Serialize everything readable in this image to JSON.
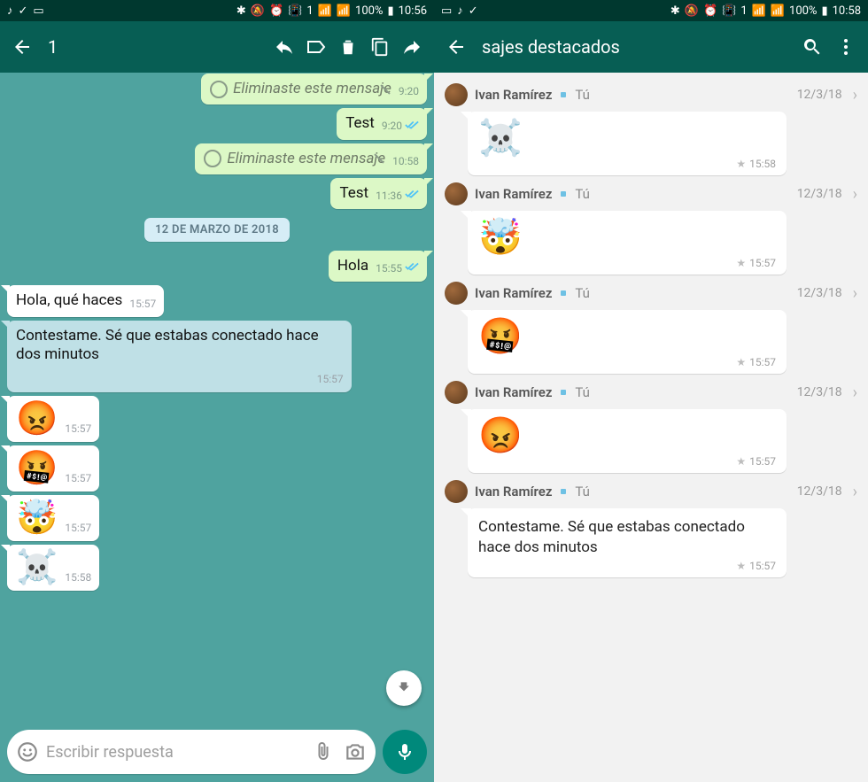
{
  "left": {
    "status": {
      "time": "10:56",
      "battery": "100%",
      "icons_left": [
        "♪",
        "✓",
        "▭"
      ],
      "icons_right": [
        "✱",
        "🔕",
        "⏰",
        "📳",
        "1",
        "📶",
        "📶"
      ]
    },
    "actionbar": {
      "back": "←",
      "count": "1",
      "reply_icon": "reply",
      "label_icon": "label",
      "delete_icon": "delete",
      "copy_icon": "copy",
      "forward_icon": "forward"
    },
    "messages": [
      {
        "kind": "out",
        "deleted": true,
        "text": "Eliminaste este mensaje",
        "time": "9:20",
        "cut": true
      },
      {
        "kind": "out",
        "text": "Test",
        "time": "9:20",
        "ticks": "read"
      },
      {
        "kind": "out",
        "deleted": true,
        "text": "Eliminaste este mensaje",
        "time": "10:58"
      },
      {
        "kind": "out",
        "text": "Test",
        "time": "11:36",
        "ticks": "read"
      },
      {
        "kind": "date",
        "text": "12 DE MARZO DE 2018"
      },
      {
        "kind": "out",
        "text": "Hola",
        "time": "15:55",
        "ticks": "read"
      },
      {
        "kind": "in",
        "text": "Hola, qué haces",
        "time": "15:57"
      },
      {
        "kind": "in",
        "selected": true,
        "text": "Contestame. Sé que estabas conectado hace dos minutos",
        "time": "15:57"
      },
      {
        "kind": "in",
        "emoji": "😡",
        "time": "15:57"
      },
      {
        "kind": "in",
        "emoji": "🤬",
        "time": "15:57"
      },
      {
        "kind": "in",
        "emoji": "🤯",
        "time": "15:57"
      },
      {
        "kind": "in",
        "emoji": "☠️",
        "time": "15:58"
      }
    ],
    "composer": {
      "placeholder": "Escribir respuesta"
    }
  },
  "right": {
    "status": {
      "time": "10:58",
      "battery": "100%",
      "icons_left": [
        "▭",
        "♪",
        "✓"
      ],
      "icons_right": [
        "✱",
        "🔕",
        "⏰",
        "📳",
        "1",
        "📶",
        "📶"
      ]
    },
    "actionbar": {
      "title": "sajes destacados"
    },
    "items": [
      {
        "name": "Ivan Ramírez",
        "to": "Tú",
        "date": "12/3/18",
        "emoji": "☠️",
        "time": "15:58"
      },
      {
        "name": "Ivan Ramírez",
        "to": "Tú",
        "date": "12/3/18",
        "emoji": "🤯",
        "time": "15:57"
      },
      {
        "name": "Ivan Ramírez",
        "to": "Tú",
        "date": "12/3/18",
        "emoji": "🤬",
        "time": "15:57"
      },
      {
        "name": "Ivan Ramírez",
        "to": "Tú",
        "date": "12/3/18",
        "emoji": "😡",
        "time": "15:57"
      },
      {
        "name": "Ivan Ramírez",
        "to": "Tú",
        "date": "12/3/18",
        "text": "Contestame. Sé que estabas conectado hace dos minutos",
        "time": "15:57"
      }
    ]
  }
}
